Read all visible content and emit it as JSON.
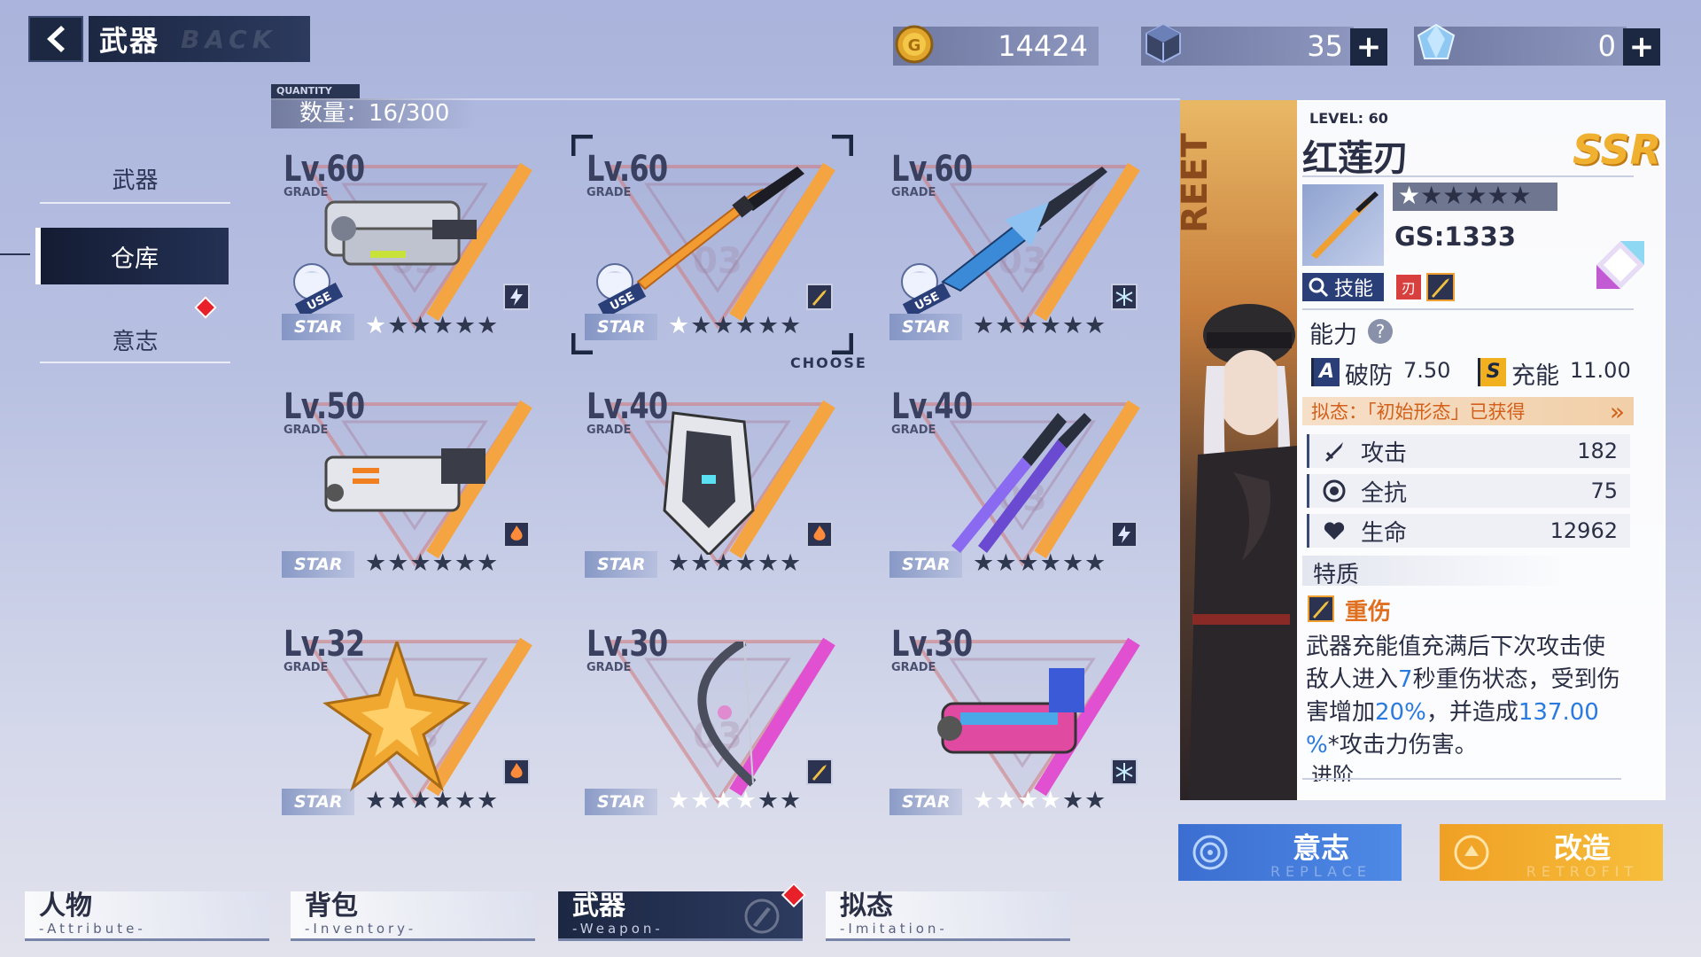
{
  "header": {
    "title": "武器",
    "title_watermark": "BACK",
    "gold": "14424",
    "cube": "35",
    "crystal": "0",
    "plus": "+"
  },
  "quantity": {
    "tag": "QUANTITY",
    "text": "数量：16/300"
  },
  "side_menu": {
    "items": [
      {
        "label": "武器"
      },
      {
        "label": "仓库"
      },
      {
        "label": "意志"
      }
    ]
  },
  "cards": [
    {
      "level": "Lv.60",
      "grade": "GRADE",
      "stars_lit": 1,
      "element": "lightning",
      "in_use": true,
      "weapon": "gauntlet"
    },
    {
      "level": "Lv.60",
      "grade": "GRADE",
      "stars_lit": 1,
      "element": "blade",
      "in_use": true,
      "weapon": "katana",
      "selected": true
    },
    {
      "level": "Lv.60",
      "grade": "GRADE",
      "stars_lit": 0,
      "element": "ice",
      "in_use": true,
      "weapon": "spear"
    },
    {
      "level": "Lv.50",
      "grade": "GRADE",
      "stars_lit": 0,
      "element": "fire",
      "in_use": false,
      "weapon": "cannon"
    },
    {
      "level": "Lv.40",
      "grade": "GRADE",
      "stars_lit": 0,
      "element": "fire",
      "in_use": false,
      "weapon": "shield"
    },
    {
      "level": "Lv.40",
      "grade": "GRADE",
      "stars_lit": 0,
      "element": "lightning",
      "in_use": false,
      "weapon": "claws"
    },
    {
      "level": "Lv.32",
      "grade": "GRADE",
      "stars_lit": 0,
      "element": "fire",
      "in_use": false,
      "weapon": "star"
    },
    {
      "level": "Lv.30",
      "grade": "GRADE",
      "stars_lit": 4,
      "element": "blade",
      "in_use": false,
      "weapon": "bow"
    },
    {
      "level": "Lv.30",
      "grade": "GRADE",
      "stars_lit": 4,
      "element": "ice",
      "in_use": false,
      "weapon": "blaster"
    }
  ],
  "labels": {
    "star": "STAR",
    "use": "USE",
    "choose": "CHOOSE"
  },
  "detail": {
    "level": "LEVEL: 60",
    "name": "红莲刃",
    "rarity": "SSR",
    "gs": "GS:1333",
    "skill_btn": "技能",
    "ability_header": "能力",
    "ability_help": "?",
    "break_grade": "A",
    "break_label": "破防",
    "break_value": "7.50",
    "charge_grade": "S",
    "charge_label": "充能",
    "charge_value": "11.00",
    "imitation": "拟态：「初始形态」已获得",
    "imitation_arrow": "»",
    "stats": [
      {
        "label": "攻击",
        "value": "182",
        "icon": "sword-icon"
      },
      {
        "label": "全抗",
        "value": "75",
        "icon": "shield-gear-icon"
      },
      {
        "label": "生命",
        "value": "12962",
        "icon": "heart-icon"
      }
    ],
    "trait_header": "特质",
    "trait_name": "重伤",
    "trait_desc_1": "武器充能值充满后下次攻击使",
    "trait_desc_2a": "敌人进入",
    "trait_desc_2b": "7",
    "trait_desc_2c": "秒重伤状态，受到伤",
    "trait_desc_3a": "害增加",
    "trait_desc_3b": "20%",
    "trait_desc_3c": "，并造成",
    "trait_desc_3d": "137.00",
    "trait_desc_4a": "%",
    "trait_desc_4b": "*攻击力伤害。",
    "advance": "进阶",
    "portrait_text": "REET"
  },
  "actions": {
    "will": "意志",
    "will_sub": "REPLACE",
    "modify": "改造",
    "modify_sub": "RETROFIT"
  },
  "bottom_tabs": [
    {
      "label": "人物",
      "sub": "-Attribute-"
    },
    {
      "label": "背包",
      "sub": "-Inventory-"
    },
    {
      "label": "武器",
      "sub": "-Weapon-"
    },
    {
      "label": "拟态",
      "sub": "-Imitation-"
    }
  ],
  "colors": {
    "accent_orange": "#f5a442",
    "accent_pink": "#e050d0",
    "navy": "#1c2742",
    "trait_blue": "#2a7ae0",
    "alert_red": "#e8202a"
  }
}
